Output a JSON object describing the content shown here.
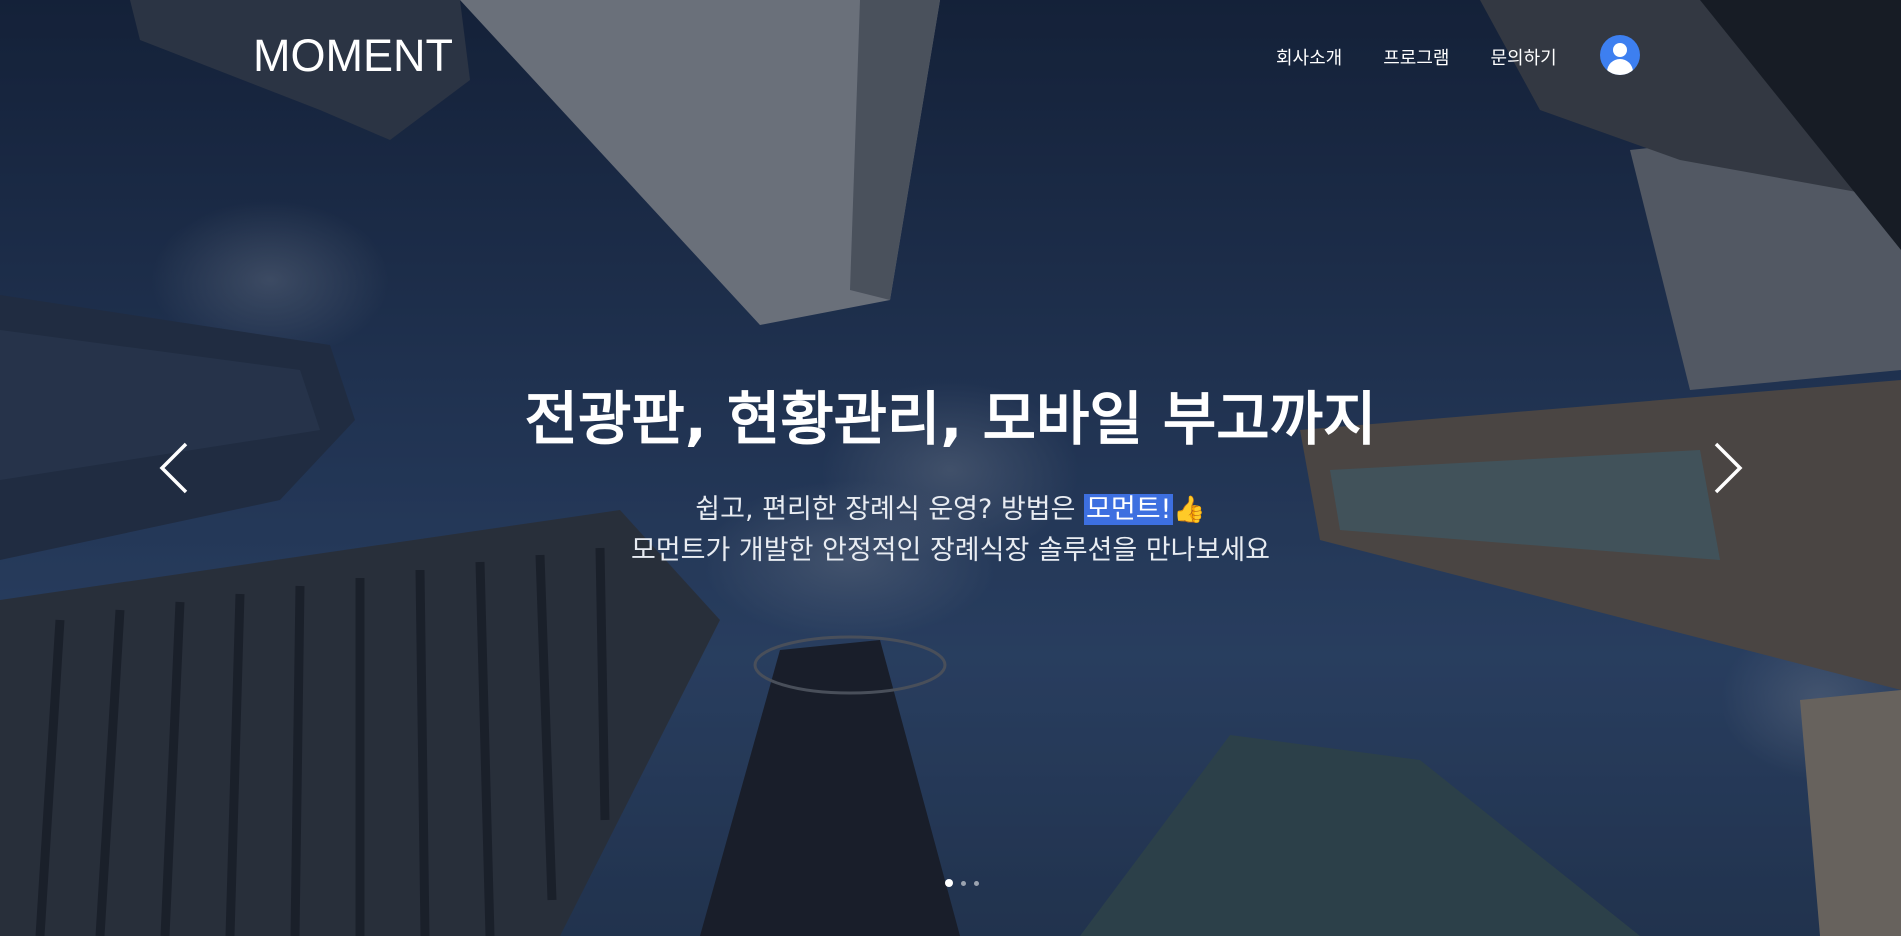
{
  "header": {
    "logo": "MOMENT",
    "nav": [
      {
        "label": "회사소개"
      },
      {
        "label": "프로그램"
      },
      {
        "label": "문의하기"
      }
    ],
    "avatar_icon": "user-icon"
  },
  "hero": {
    "headline": "전광판, 현황관리, 모바일 부고까지",
    "subline1_prefix": "쉽고, 편리한 장례식 운영? 방법은 ",
    "subline1_highlight": "모먼트!",
    "subline1_emoji": "👍",
    "subline2": "모먼트가 개발한 안정적인 장례식장 솔루션을 만나보세요",
    "prev_icon": "chevron-left-icon",
    "next_icon": "chevron-right-icon",
    "slides": 3,
    "active_slide": 1
  },
  "colors": {
    "accent": "#3d7ff0",
    "highlight_bg": "#3d6fe0",
    "text": "#ffffff"
  }
}
